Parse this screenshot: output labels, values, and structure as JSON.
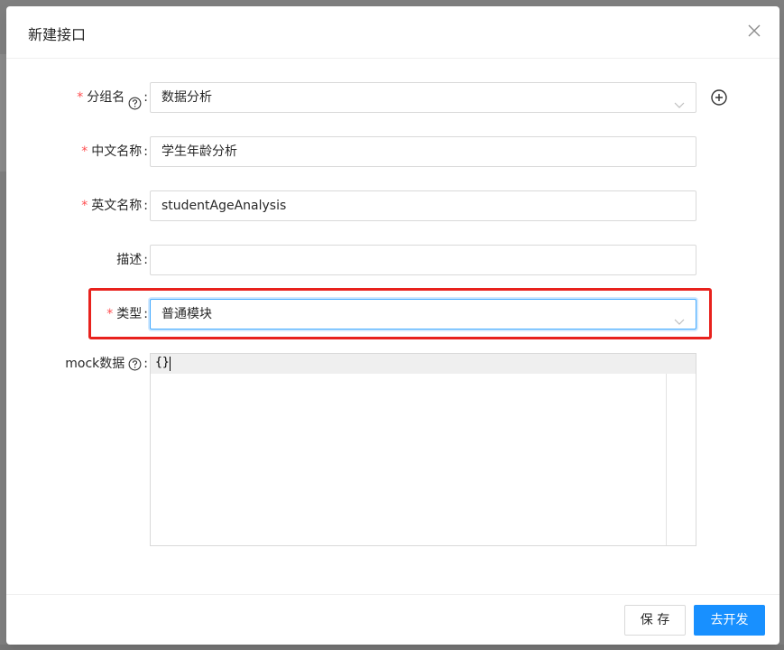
{
  "modal": {
    "title": "新建接口",
    "close_icon": "close-icon"
  },
  "form": {
    "group": {
      "required": "*",
      "label": "分组名",
      "colon": ":",
      "help_icon": "question-circle-icon",
      "value": "数据分析",
      "add_icon": "plus-circle-icon"
    },
    "cn_name": {
      "required": "*",
      "label": "中文名称",
      "colon": ":",
      "value": "学生年龄分析"
    },
    "en_name": {
      "required": "*",
      "label": "英文名称",
      "colon": ":",
      "value": "studentAgeAnalysis"
    },
    "description": {
      "label": "描述",
      "colon": ":",
      "value": ""
    },
    "type": {
      "required": "*",
      "label": "类型",
      "colon": ":",
      "value": "普通模块",
      "highlight_color": "#e8221d"
    },
    "mock": {
      "label": "mock数据",
      "colon": ":",
      "help_icon": "question-circle-icon",
      "value": "{}"
    }
  },
  "footer": {
    "save_label": "保 存",
    "develop_label": "去开发"
  },
  "colors": {
    "primary": "#1890ff",
    "required": "#ff4d4f",
    "focus_border": "#40a9ff"
  }
}
